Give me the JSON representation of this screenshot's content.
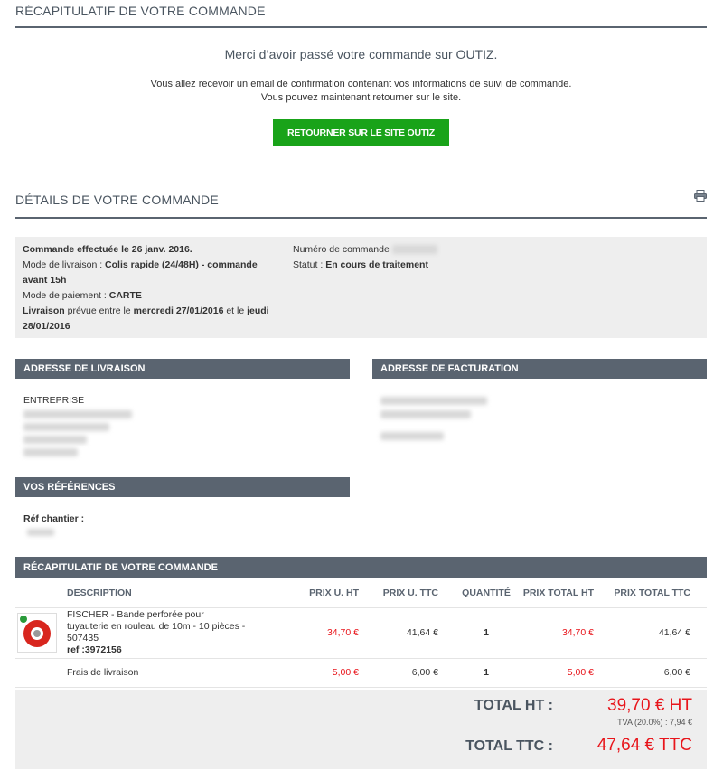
{
  "header": {
    "title": "RÉCAPITULATIF DE VOTRE COMMANDE"
  },
  "confirmation": {
    "thanks": "Merci d’avoir passé votre commande sur OUTIZ.",
    "line1": "Vous allez recevoir un email de confirmation contenant vos informations de suivi de commande.",
    "line2": "Vous pouvez maintenant retourner sur le site.",
    "button": "RETOURNER SUR LE SITE OUTIZ"
  },
  "details": {
    "title": "DÉTAILS DE VOTRE COMMANDE",
    "print_icon": "printer-icon",
    "order_date": "Commande effectuée le 26 janv. 2016.",
    "delivery_mode_label": "Mode de livraison : ",
    "delivery_mode_value": "Colis rapide (24/48H) - commande avant 15h",
    "payment_label": "Mode de paiement : ",
    "payment_value": "CARTE",
    "livraison_word": "Livraison",
    "livraison_text1": " prévue entre le ",
    "livraison_date1": "mercredi 27/01/2016",
    "livraison_text2": " et le ",
    "livraison_date2": "jeudi 28/01/2016",
    "order_number_label": "Numéro de commande",
    "status_label": "Statut : ",
    "status_value": "En cours de traitement"
  },
  "shipping": {
    "title": "ADRESSE DE LIVRAISON",
    "line1": "ENTREPRISE"
  },
  "billing": {
    "title": "ADRESSE DE FACTURATION"
  },
  "references": {
    "title": "VOS RÉFÉRENCES",
    "chantier_label": "Réf chantier :"
  },
  "order_table": {
    "title": "RÉCAPITULATIF DE VOTRE COMMANDE",
    "headers": [
      "DESCRIPTION",
      "PRIX U. HT",
      "PRIX U. TTC",
      "QUANTITÉ",
      "PRIX TOTAL HT",
      "PRIX TOTAL TTC"
    ],
    "rows": [
      {
        "description": "FISCHER - Bande perforée pour tuyauterie en rouleau de 10m - 10 pièces - 507435",
        "ref": "ref :3972156",
        "unit_ht": "34,70 €",
        "unit_ttc": "41,64 €",
        "qty": "1",
        "total_ht": "34,70 €",
        "total_ttc": "41,64 €"
      },
      {
        "description": "Frais de livraison",
        "unit_ht": "5,00 €",
        "unit_ttc": "6,00 €",
        "qty": "1",
        "total_ht": "5,00 €",
        "total_ttc": "6,00 €"
      }
    ]
  },
  "totals": {
    "ht_label": "TOTAL HT :",
    "ht_value": "39,70 € HT",
    "tva": "TVA (20.0%) : 7,94 €",
    "ttc_label": "TOTAL TTC :",
    "ttc_value": "47,64 € TTC"
  },
  "colors": {
    "accent_green": "#19a319",
    "bar_gray": "#5a6470",
    "price_red": "#e8151b"
  }
}
